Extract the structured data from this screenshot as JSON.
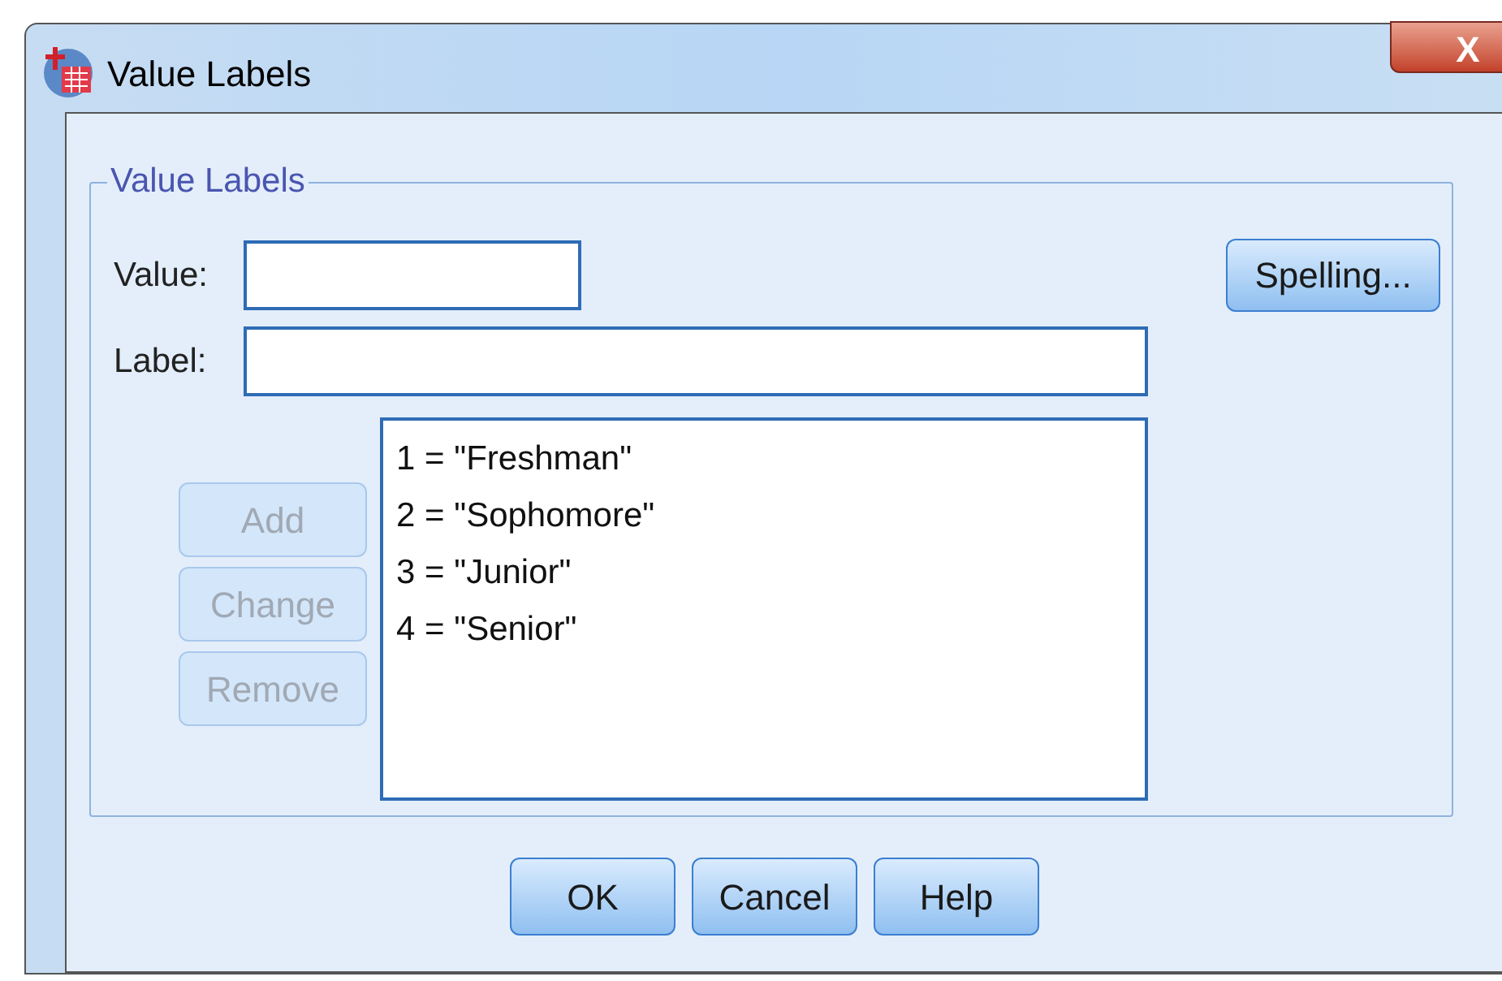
{
  "window": {
    "title": "Value Labels",
    "close": "X"
  },
  "group": {
    "title": "Value Labels",
    "value_field": {
      "label": "Value:"
    },
    "label_field": {
      "label": "Label:"
    },
    "spelling_button": {
      "label": "Spelling...",
      "disabled": false
    },
    "action_buttons": [
      {
        "label": "Add",
        "disabled": true
      },
      {
        "label": "Change",
        "disabled": true
      },
      {
        "label": "Remove",
        "disabled": true
      }
    ],
    "list_items": [
      {
        "text": "1 = \"Freshman\"",
        "selected": false
      },
      {
        "text": "2 = \"Sophomore\"",
        "selected": false
      },
      {
        "text": "3 = \"Junior\"",
        "selected": false
      },
      {
        "text": "4 = \"Senior\"",
        "selected": false
      }
    ]
  },
  "buttons": [
    {
      "label": "OK",
      "disabled": false
    },
    {
      "label": "Cancel",
      "disabled": false
    },
    {
      "label": "Help",
      "disabled": false
    }
  ]
}
